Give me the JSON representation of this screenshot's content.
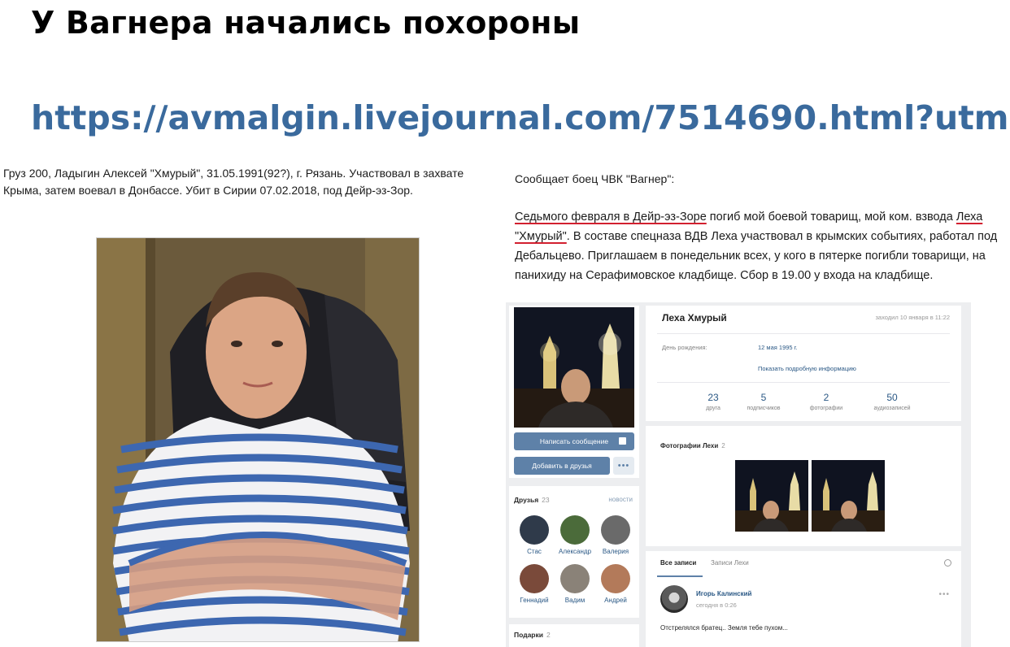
{
  "headline": "У Вагнера начались похороны",
  "link": "https://avmalgin.livejournal.com/7514690.html?utm...",
  "left_caption": "Груз 200, Ладыгин Алексей \"Хмурый\", 31.05.1991(92?), г. Рязань. Участвовал в захвате Крыма, затем воевал в Донбассе. Убит в Сирии 07.02.2018, под Дейр-эз-Зор.",
  "right": {
    "intro": "Сообщает боец ЧВК \"Вагнер\":",
    "quote": {
      "p1_underlined": "Седьмого февраля в Дейр-эз-Зоре",
      "p2": " погиб мой боевой товарищ, мой ком. взвода ",
      "p3_underlined": "Леха \"Хмурый\"",
      "p4": ". В составе спецназа ВДВ Леха участвовал в крымских событиях, работал под Дебальцево. Приглашаем в понедельник всех, у кого в пятерке погибли товарищи, на панихиду на Серафимовское кладбище. Сбор в 19.00 у входа на кладбище."
    }
  },
  "vk": {
    "name": "Леха Хмурый",
    "last_seen": "заходил 10 января в 11:22",
    "birthday_label": "День рождения:",
    "birthday_value": "12 мая 1995 г.",
    "show_more": "Показать подробную информацию",
    "stats": [
      {
        "num": "23",
        "label": "друга"
      },
      {
        "num": "5",
        "label": "подписчиков"
      },
      {
        "num": "2",
        "label": "фотографии"
      },
      {
        "num": "50",
        "label": "аудиозаписей"
      }
    ],
    "btn_message": "Написать сообщение",
    "btn_add": "Добавить в друзья",
    "btn_more": "•••",
    "friends_title": "Друзья",
    "friends_count": "23",
    "friends_news": "новости",
    "friends": [
      {
        "name": "Стас",
        "color": "#2f3a4a"
      },
      {
        "name": "Александр",
        "color": "#4b6b3a"
      },
      {
        "name": "Валерия",
        "color": "#6a6a6a"
      },
      {
        "name": "Геннадий",
        "color": "#7a4a3a"
      },
      {
        "name": "Вадим",
        "color": "#8a8278"
      },
      {
        "name": "Андрей",
        "color": "#b37a5a"
      }
    ],
    "gifts_title": "Подарки",
    "gifts_count": "2",
    "photos_title": "Фотографии Лехи",
    "photos_count": "2",
    "wall_tab1": "Все записи",
    "wall_tab2": "Записи Лехи",
    "post_author": "Игорь Калинский",
    "post_time": "сегодня в 0:26",
    "post_dots": "•••",
    "post_text": "Отстрелялся братец.. Земля тебе пухом..."
  }
}
